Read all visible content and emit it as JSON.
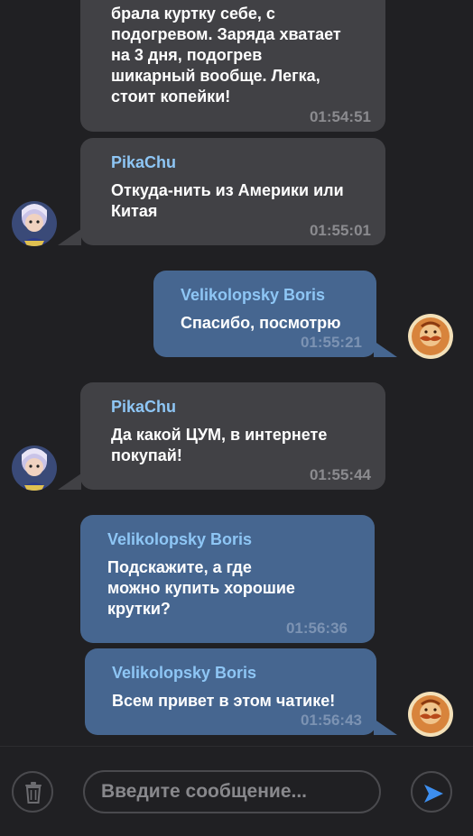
{
  "messages": [
    {
      "direction": "in",
      "author": "",
      "lines": [
        "брала куртку себе, с",
        "подогревом. Заряда хватает",
        "на 3 дня, подогрев",
        "шикарный вообще. Легка,",
        "стоит копейки!"
      ],
      "time": "01:54:51"
    },
    {
      "direction": "in",
      "author": "PikaChu",
      "lines": [
        "Откуда-нить из Америки или",
        "Китая"
      ],
      "time": "01:55:01"
    },
    {
      "direction": "out",
      "author": "Velikolopsky Boris",
      "lines": [
        "Спасибо, посмотрю"
      ],
      "time": "01:55:21"
    },
    {
      "direction": "in",
      "author": "PikaChu",
      "lines": [
        "Да какой ЦУМ, в интернете",
        "покупай!"
      ],
      "time": "01:55:44"
    },
    {
      "direction": "out",
      "author": "Velikolopsky Boris",
      "lines": [
        "Подскажите, а где",
        "можно купить хорошие",
        "крутки?"
      ],
      "time": "01:56:36"
    },
    {
      "direction": "out",
      "author": "Velikolopsky Boris",
      "lines": [
        "Всем привет в этом чатике!"
      ],
      "time": "01:56:43"
    }
  ],
  "composer": {
    "placeholder": "Введите сообщение..."
  },
  "colors": {
    "background": "#202023",
    "incoming_bubble": "#414145",
    "outgoing_bubble": "#466690",
    "author": "#8ec6f5",
    "send_arrow": "#3d8ff0"
  },
  "icons": {
    "delete": "trash-icon",
    "send": "send-arrow-icon",
    "incoming_avatar": "avatar-pikachu",
    "outgoing_avatar": "avatar-boris"
  }
}
